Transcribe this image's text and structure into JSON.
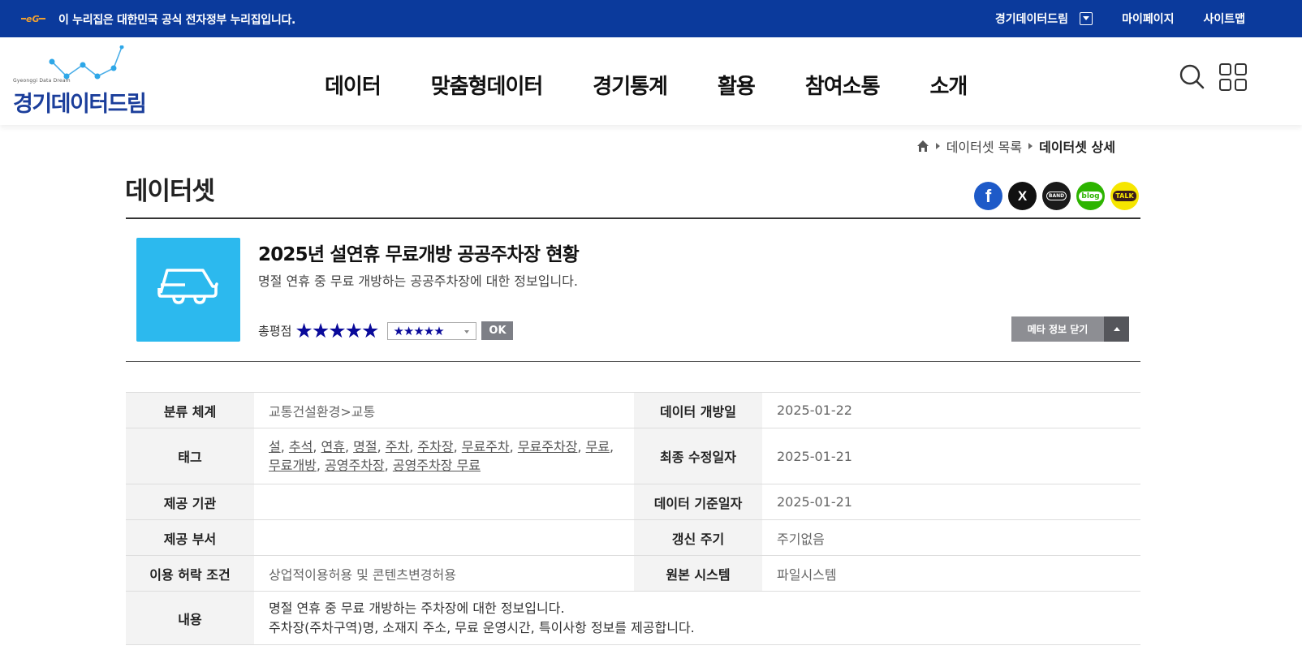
{
  "gov_banner": {
    "text": "이 누리집은 대한민국 공식 전자정부 누리집입니다.",
    "site_link": "경기데이터드림",
    "mypage": "마이페이지",
    "sitemap": "사이트맵"
  },
  "header": {
    "logo_small": "Gyeonggi Data Dream",
    "logo_text": "경기데이터드림",
    "nav": [
      "데이터",
      "맞춤형데이터",
      "경기통계",
      "활용",
      "참여소통",
      "소개"
    ]
  },
  "breadcrumb": {
    "list": "데이터셋 목록",
    "current": "데이터셋 상세"
  },
  "page_title": "데이터셋",
  "share": {
    "facebook": "f",
    "x": "X",
    "band": "BAND",
    "blog": "blog",
    "talk": "TALK"
  },
  "dataset": {
    "title": "2025년 설연휴 무료개방 공공주차장 현황",
    "description": "명절 연휴 중 무료 개방하는 공공주차장에 대한 정보입니다.",
    "rating_label": "총평점",
    "stars": "★★★★★",
    "select_stars": "★★★★★",
    "rating_value": 5,
    "ok_label": "OK",
    "meta_toggle": "메타 정보 닫기"
  },
  "meta": {
    "category_label": "분류 체계",
    "category_value": "교통건설환경>교통",
    "open_date_label": "데이터 개방일",
    "open_date_value": "2025-01-22",
    "tags_label": "태그",
    "tags": [
      "설",
      "추석",
      "연휴",
      "명절",
      "주차",
      "주차장",
      "무료주차",
      "무료주차장",
      "무료",
      "무료개방",
      "공영주차장",
      "공영주차장 무료"
    ],
    "modified_label": "최종 수정일자",
    "modified_value": "2025-01-21",
    "org_label": "제공 기관",
    "org_value": "",
    "base_date_label": "데이터 기준일자",
    "base_date_value": "2025-01-21",
    "dept_label": "제공 부서",
    "dept_value": "",
    "cycle_label": "갱신 주기",
    "cycle_value": "주기없음",
    "license_label": "이용 허락 조건",
    "license_value": "상업적이용허용 및 콘텐츠변경허용",
    "system_label": "원본 시스템",
    "system_value": "파일시스템",
    "content_label": "내용",
    "content_lines": [
      "명절 연휴 중 무료 개방하는 주차장에 대한 정보입니다.",
      "주차장(주차구역)명, 소재지 주소, 무료 운영시간, 특이사항 정보를 제공합니다."
    ]
  },
  "colors": {
    "gov_bar": "#0b3a9c",
    "logo_blue": "#1b3e9b",
    "thumb": "#2cb9ee",
    "star": "#0a0a9a"
  }
}
